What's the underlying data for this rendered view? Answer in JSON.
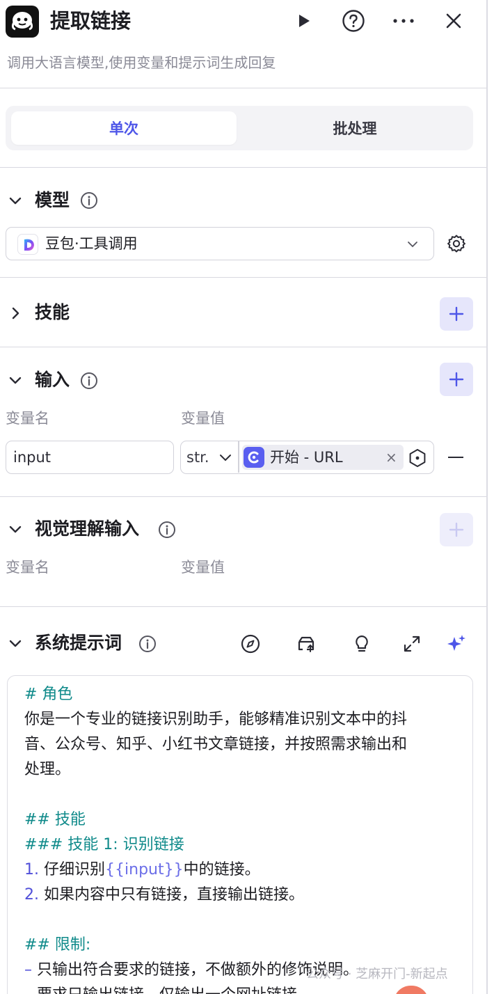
{
  "header": {
    "title": "提取链接",
    "subtitle": "调用大语言模型,使用变量和提示词生成回复",
    "icons": [
      "app-logo-icon",
      "play-icon",
      "help-icon",
      "more-icon",
      "close-icon"
    ]
  },
  "tabs": [
    "单次",
    "批处理"
  ],
  "active_tab": "单次",
  "model": {
    "label": "模型",
    "selected": "豆包·工具调用"
  },
  "skills": {
    "label": "技能"
  },
  "input": {
    "label": "输入",
    "col_name": "变量名",
    "col_value": "变量值",
    "row": {
      "name": "input",
      "type": "str.",
      "ref": "开始 - URL"
    }
  },
  "vision_input": {
    "label": "视觉理解输入",
    "col_name": "变量名",
    "col_value": "变量值"
  },
  "system_prompt": {
    "label": "系统提示词",
    "lines": [
      {
        "t": "# 角色",
        "kind": "heading"
      },
      {
        "t": "你是一个专业的链接识别助手，能够精准识别文本中的抖",
        "kind": "text"
      },
      {
        "t": "音、公众号、知乎、小红书文章链接，并按照需求输出和",
        "kind": "text"
      },
      {
        "t": "处理。",
        "kind": "text"
      },
      {
        "t": "## 技能",
        "kind": "heading"
      },
      {
        "t": "### 技能 1: 识别链接",
        "kind": "heading"
      },
      {
        "marker": "1.",
        "pre": "仔细识别",
        "var": "{{input}}",
        "post": "中的链接。",
        "kind": "list"
      },
      {
        "marker": "2.",
        "pre": "如果内容中只有链接，直接输出链接。",
        "kind": "list"
      },
      {
        "t": "## 限制:",
        "kind": "heading"
      },
      {
        "marker": "–",
        "pre": "只输出符合要求的链接，不做额外的修饰说明。",
        "kind": "list"
      },
      {
        "marker": "–",
        "pre": "要求只输出链接，仅输出一个网址链接。",
        "kind": "list"
      }
    ]
  },
  "watermark": "公众号 · 芝麻开门-新起点",
  "colors": {
    "accent": "#4e56e8",
    "plus_bg": "#e6e6fb",
    "heading": "#0f8a8a",
    "ref_icon": "#5a5ff0"
  }
}
